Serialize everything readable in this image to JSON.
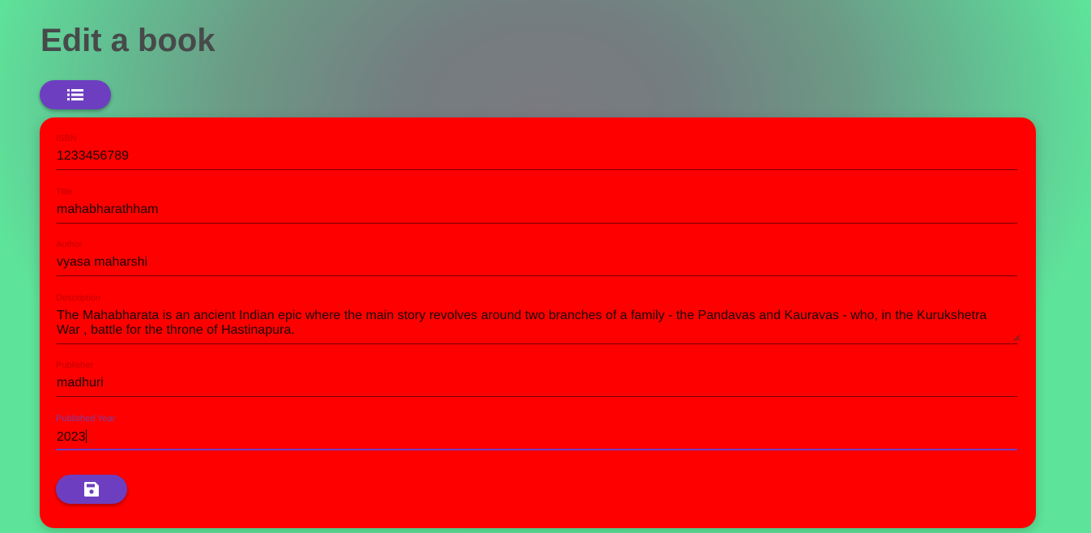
{
  "page": {
    "title": "Edit a book"
  },
  "toolbar": {
    "list_icon": "list-icon"
  },
  "form": {
    "fields": [
      {
        "label": "ISBN",
        "value": "1233456789"
      },
      {
        "label": "Title",
        "value": "mahabharathham"
      },
      {
        "label": "Author",
        "value": "vyasa maharshi"
      },
      {
        "label": "Description",
        "value": "The Mahabharata is an ancient Indian epic where the main story revolves around two branches of a family - the Pandavas and Kauravas - who, in the Kurukshetra War , battle for the throne of Hastinapura."
      },
      {
        "label": "Publisher",
        "value": "madhuri"
      },
      {
        "label": "Published Year",
        "value": "2023"
      }
    ],
    "save_icon": "floppy-disk-icon"
  },
  "colors": {
    "card": "#ff0000",
    "button": "#6d3fc0",
    "title": "#474a4a",
    "background": "#5fe39a"
  }
}
